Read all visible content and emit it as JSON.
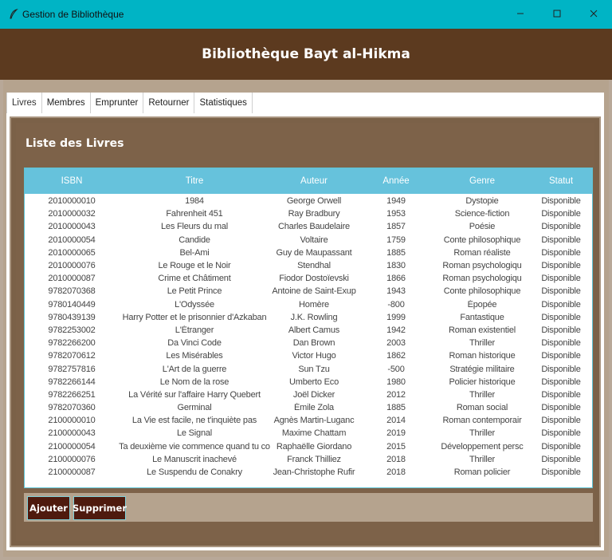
{
  "window": {
    "title": "Gestion de Bibliothèque",
    "minimize": "–",
    "maximize": "☐",
    "close": "✕"
  },
  "header": {
    "title": "Bibliothèque Bayt al-Hikma"
  },
  "tabs": [
    {
      "label": "Livres"
    },
    {
      "label": "Membres"
    },
    {
      "label": "Emprunter"
    },
    {
      "label": "Retourner"
    },
    {
      "label": "Statistiques"
    }
  ],
  "section": {
    "title": "Liste des Livres"
  },
  "table": {
    "columns": [
      "ISBN",
      "Titre",
      "Auteur",
      "Année",
      "Genre",
      "Statut"
    ],
    "rows": [
      [
        "2010000010",
        "1984",
        "George Orwell",
        "1949",
        "Dystopie",
        "Disponible"
      ],
      [
        "2010000032",
        "Fahrenheit 451",
        "Ray Bradbury",
        "1953",
        "Science-fiction",
        "Disponible"
      ],
      [
        "2010000043",
        "Les Fleurs du mal",
        "Charles Baudelaire",
        "1857",
        "Poésie",
        "Disponible"
      ],
      [
        "2010000054",
        "Candide",
        "Voltaire",
        "1759",
        "Conte philosophique",
        "Disponible"
      ],
      [
        "2010000065",
        "Bel-Ami",
        "Guy de Maupassant",
        "1885",
        "Roman réaliste",
        "Disponible"
      ],
      [
        "2010000076",
        "Le Rouge et le Noir",
        "Stendhal",
        "1830",
        "Roman psychologiqu",
        "Disponible"
      ],
      [
        "2010000087",
        "Crime et Châtiment",
        "Fiodor Dostoïevski",
        "1866",
        "Roman psychologiqu",
        "Disponible"
      ],
      [
        "9782070368",
        "Le Petit Prince",
        "Antoine de Saint-Exup",
        "1943",
        "Conte philosophique",
        "Disponible"
      ],
      [
        "9780140449",
        "L'Odyssée",
        "Homère",
        "-800",
        "Épopée",
        "Disponible"
      ],
      [
        "9780439139",
        "Harry Potter et le prisonnier d'Azkaban",
        "J.K. Rowling",
        "1999",
        "Fantastique",
        "Disponible"
      ],
      [
        "9782253002",
        "L'Étranger",
        "Albert Camus",
        "1942",
        "Roman existentiel",
        "Disponible"
      ],
      [
        "9782266200",
        "Da Vinci Code",
        "Dan Brown",
        "2003",
        "Thriller",
        "Disponible"
      ],
      [
        "9782070612",
        "Les Misérables",
        "Victor Hugo",
        "1862",
        "Roman historique",
        "Disponible"
      ],
      [
        "9782757816",
        "L'Art de la guerre",
        "Sun Tzu",
        "-500",
        "Stratégie militaire",
        "Disponible"
      ],
      [
        "9782266144",
        "Le Nom de la rose",
        "Umberto Eco",
        "1980",
        "Policier historique",
        "Disponible"
      ],
      [
        "9782266251",
        "La Vérité sur l'affaire Harry Quebert",
        "Joël Dicker",
        "2012",
        "Thriller",
        "Disponible"
      ],
      [
        "9782070360",
        "Germinal",
        "Émile Zola",
        "1885",
        "Roman social",
        "Disponible"
      ],
      [
        "2100000010",
        "La Vie est facile, ne t'inquiète pas",
        "Agnès Martin-Luganc",
        "2014",
        "Roman contemporair",
        "Disponible"
      ],
      [
        "2100000043",
        "Le Signal",
        "Maxime Chattam",
        "2019",
        "Thriller",
        "Disponible"
      ],
      [
        "2100000054",
        "Ta deuxième vie commence quand tu co",
        "Raphaëlle Giordano",
        "2015",
        "Développement persc",
        "Disponible"
      ],
      [
        "2100000076",
        "Le Manuscrit inachevé",
        "Franck Thilliez",
        "2018",
        "Thriller",
        "Disponible"
      ],
      [
        "2100000087",
        "Le Suspendu de Conakry",
        "Jean-Christophe Rufir",
        "2018",
        "Roman policier",
        "Disponible"
      ]
    ]
  },
  "buttons": {
    "add": "Ajouter",
    "delete": "Supprimer"
  },
  "colors": {
    "titlebar": "#00b4c5",
    "header": "#5c3a1f",
    "panel": "#7b6148",
    "table_header": "#66c2dc",
    "button": "#4e1a0e"
  }
}
